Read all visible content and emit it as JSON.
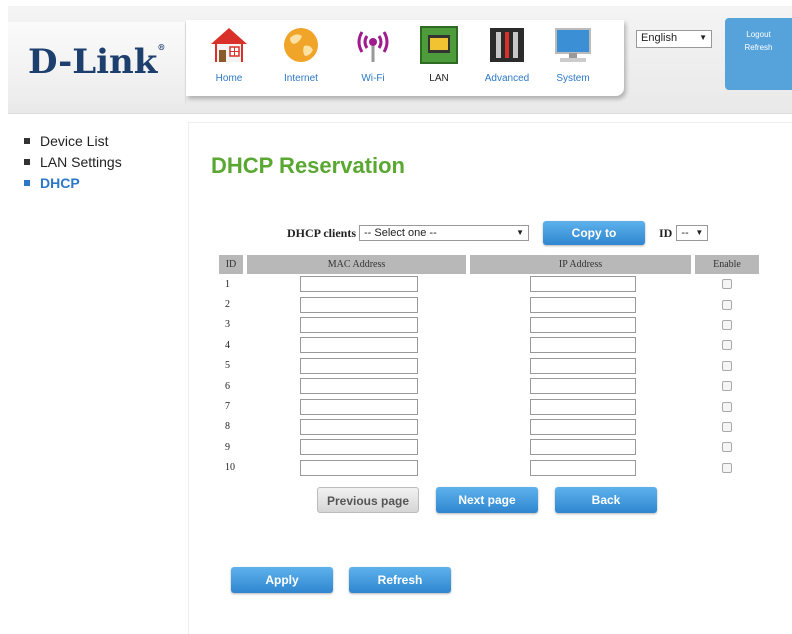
{
  "brand": {
    "logo_text": "D-Link",
    "registered_mark": "®"
  },
  "nav": {
    "items": [
      {
        "label": "Home",
        "icon": "home-icon",
        "active": false
      },
      {
        "label": "Internet",
        "icon": "globe-icon",
        "active": false
      },
      {
        "label": "Wi-Fi",
        "icon": "wifi-icon",
        "active": false
      },
      {
        "label": "LAN",
        "icon": "lan-icon",
        "active": true
      },
      {
        "label": "Advanced",
        "icon": "tools-icon",
        "active": false
      },
      {
        "label": "System",
        "icon": "monitor-icon",
        "active": false
      }
    ]
  },
  "language": {
    "selected": "English"
  },
  "top_actions": {
    "logout": "Logout",
    "refresh": "Refresh"
  },
  "sidebar": {
    "items": [
      {
        "label": "Device List",
        "active": false
      },
      {
        "label": "LAN Settings",
        "active": false
      },
      {
        "label": "DHCP",
        "active": true
      }
    ]
  },
  "page": {
    "title": "DHCP Reservation"
  },
  "clients": {
    "label": "DHCP clients",
    "selected": "-- Select one --",
    "copy_label": "Copy to",
    "id_label": "ID",
    "id_selected": "--"
  },
  "table": {
    "headers": {
      "id": "ID",
      "mac": "MAC Address",
      "ip": "IP Address",
      "enable": "Enable"
    },
    "rows": [
      {
        "id": "1",
        "mac": "",
        "ip": "",
        "enabled": false
      },
      {
        "id": "2",
        "mac": "",
        "ip": "",
        "enabled": false
      },
      {
        "id": "3",
        "mac": "",
        "ip": "",
        "enabled": false
      },
      {
        "id": "4",
        "mac": "",
        "ip": "",
        "enabled": false
      },
      {
        "id": "5",
        "mac": "",
        "ip": "",
        "enabled": false
      },
      {
        "id": "6",
        "mac": "",
        "ip": "",
        "enabled": false
      },
      {
        "id": "7",
        "mac": "",
        "ip": "",
        "enabled": false
      },
      {
        "id": "8",
        "mac": "",
        "ip": "",
        "enabled": false
      },
      {
        "id": "9",
        "mac": "",
        "ip": "",
        "enabled": false
      },
      {
        "id": "10",
        "mac": "",
        "ip": "",
        "enabled": false
      }
    ]
  },
  "pager": {
    "previous": "Previous page",
    "next": "Next page",
    "back": "Back"
  },
  "actions": {
    "apply": "Apply",
    "refresh": "Refresh"
  },
  "colors": {
    "brand_blue": "#1c3f6e",
    "title_green": "#5aa832",
    "button_blue": "#2f86cf",
    "link_blue": "#2b78c8"
  }
}
